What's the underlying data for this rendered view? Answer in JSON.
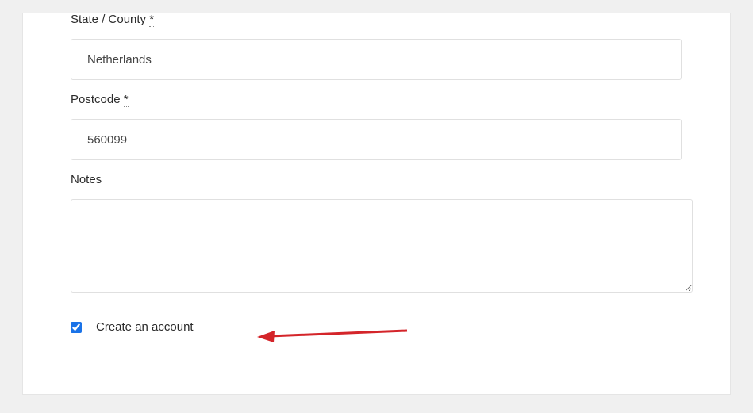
{
  "form": {
    "state": {
      "label": "State / County ",
      "required": "*",
      "value": "Netherlands"
    },
    "postcode": {
      "label": "Postcode ",
      "required": "*",
      "value": "560099"
    },
    "notes": {
      "label": "Notes",
      "value": ""
    },
    "create_account": {
      "label": "Create an account",
      "checked": true
    }
  }
}
